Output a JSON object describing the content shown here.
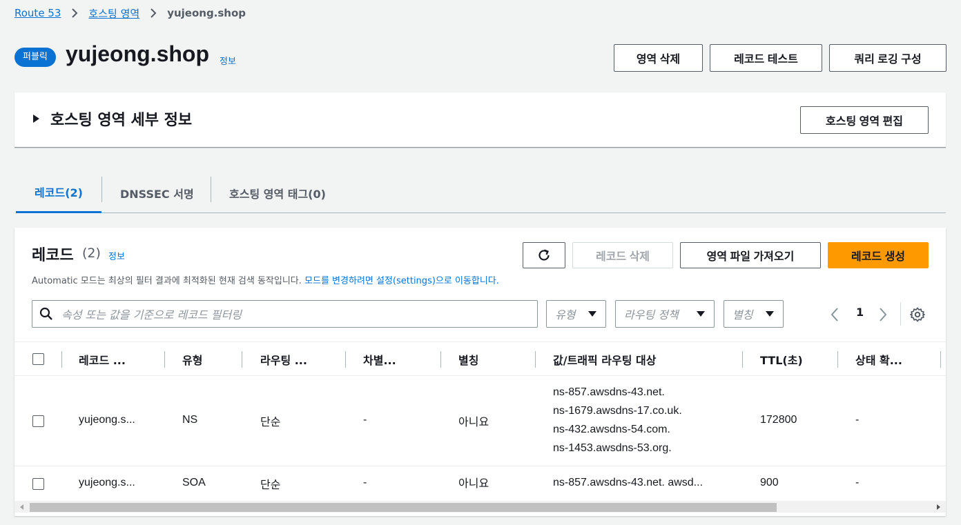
{
  "breadcrumb": {
    "items": [
      "Route 53",
      "호스팅 영역"
    ],
    "current": "yujeong.shop"
  },
  "header": {
    "badge": "퍼블릭",
    "title": "yujeong.shop",
    "info": "정보",
    "buttons": {
      "delete_zone": "영역 삭제",
      "test_record": "레코드 테스트",
      "query_logging": "쿼리 로깅 구성"
    }
  },
  "details": {
    "title": "호스팅 영역 세부 정보",
    "edit_button": "호스팅 영역 편집"
  },
  "tabs": [
    {
      "label": "레코드(2)",
      "active": true
    },
    {
      "label": "DNSSEC 서명",
      "active": false
    },
    {
      "label": "호스팅 영역 태그(0)",
      "active": false
    }
  ],
  "records": {
    "title": "레코드",
    "count": "(2)",
    "info": "정보",
    "description": "Automatic 모드는 최상의 필터 결과에 최적화된 현재 검색 동작입니다.",
    "description_link": "모드를 변경하려면 설정(settings)으로 이동합니다.",
    "buttons": {
      "delete": "레코드 삭제",
      "import": "영역 파일 가져오기",
      "create": "레코드 생성"
    },
    "search_placeholder": "속성 또는 값을 기준으로 레코드 필터링",
    "filters": {
      "type": "유형",
      "routing": "라우팅 정책",
      "alias": "별칭"
    },
    "page": "1",
    "columns": [
      "레코드 ...",
      "유형",
      "라우팅 ...",
      "차별...",
      "별칭",
      "값/트래픽 라우팅 대상",
      "TTL(초)",
      "상태 확..."
    ],
    "rows": [
      {
        "name": "yujeong.s...",
        "type": "NS",
        "routing": "단순",
        "differentiator": "-",
        "alias": "아니요",
        "values": [
          "ns-857.awsdns-43.net.",
          "ns-1679.awsdns-17.co.uk.",
          "ns-432.awsdns-54.com.",
          "ns-1453.awsdns-53.org."
        ],
        "ttl": "172800",
        "health": "-"
      },
      {
        "name": "yujeong.s...",
        "type": "SOA",
        "routing": "단순",
        "differentiator": "-",
        "alias": "아니요",
        "values": [
          "ns-857.awsdns-43.net. awsd..."
        ],
        "ttl": "900",
        "health": "-"
      }
    ]
  },
  "colors": {
    "link": "#0972d3",
    "primary": "#ff9900",
    "background": "#f2f3f3"
  }
}
